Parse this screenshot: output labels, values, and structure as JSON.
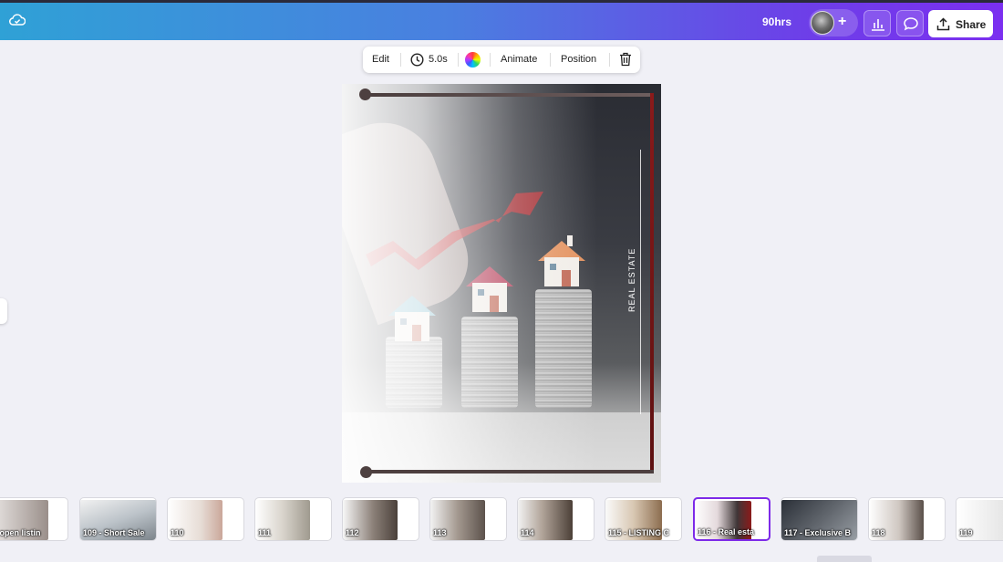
{
  "topbar": {
    "hours_label": "90hrs",
    "share_label": "Share",
    "icons": [
      "cloud-saved-icon",
      "plus-icon",
      "analytics-icon",
      "comment-icon",
      "upload-icon"
    ]
  },
  "context_toolbar": {
    "edit_label": "Edit",
    "duration_label": "5.0s",
    "animate_label": "Animate",
    "position_label": "Position"
  },
  "design": {
    "vertical_text": "REAL ESTATE"
  },
  "filmstrip": {
    "pages": [
      {
        "label": "- open listin"
      },
      {
        "label": "109 - Short Sale"
      },
      {
        "label": "110"
      },
      {
        "label": "111"
      },
      {
        "label": "112"
      },
      {
        "label": "113"
      },
      {
        "label": "114"
      },
      {
        "label": "115 - LISTING C"
      },
      {
        "label": "116 - Real esta",
        "selected": true
      },
      {
        "label": "117 - Exclusive B"
      },
      {
        "label": "118"
      },
      {
        "label": "119"
      }
    ]
  },
  "colors": {
    "topbar_gradient_start": "#2fa1d6",
    "topbar_gradient_end": "#7b2ff0",
    "selected_thumb_border": "#7d2ae8"
  }
}
